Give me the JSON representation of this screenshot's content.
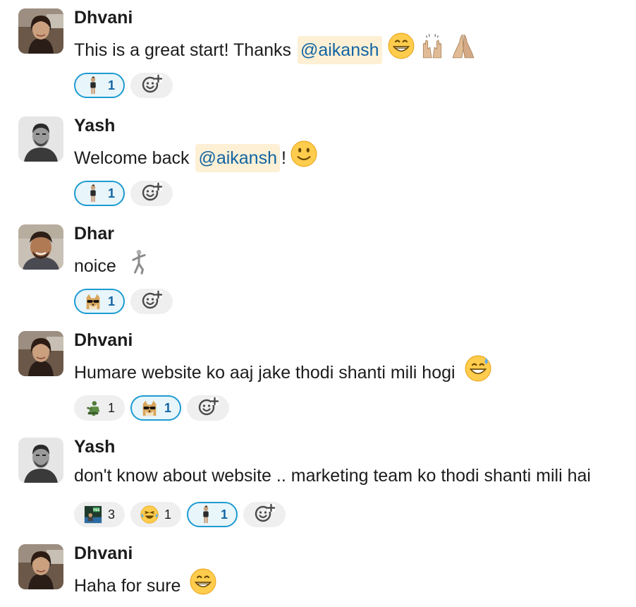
{
  "messages": [
    {
      "author": "Dhvani",
      "avatar": "dhvani-avatar",
      "parts": [
        {
          "type": "text",
          "value": "This is a great start! Thanks "
        },
        {
          "type": "mention",
          "value": "@aikansh"
        },
        {
          "type": "emoji",
          "icon": "grin-emoji"
        },
        {
          "type": "emoji",
          "icon": "raised-hands-emoji"
        },
        {
          "type": "emoji",
          "icon": "folded-hands-emoji"
        }
      ],
      "reactions": [
        {
          "icon": "standing-person-emoji",
          "count": "1",
          "active": true
        }
      ]
    },
    {
      "author": "Yash",
      "avatar": "yash-avatar",
      "parts": [
        {
          "type": "text",
          "value": "Welcome back "
        },
        {
          "type": "mention",
          "value": "@aikansh"
        },
        {
          "type": "text",
          "value": "!"
        },
        {
          "type": "emoji",
          "icon": "slight-smile-emoji"
        }
      ],
      "reactions": [
        {
          "icon": "standing-person-emoji",
          "count": "1",
          "active": true
        }
      ]
    },
    {
      "author": "Dhar",
      "avatar": "dhar-avatar",
      "parts": [
        {
          "type": "text",
          "value": "noice "
        },
        {
          "type": "emoji",
          "icon": "dancing-figure-emoji"
        }
      ],
      "reactions": [
        {
          "icon": "doge-sunglasses-emoji",
          "count": "1",
          "active": true
        }
      ]
    },
    {
      "author": "Dhvani",
      "avatar": "dhvani-avatar",
      "parts": [
        {
          "type": "text",
          "value": "Humare website ko aaj jake thodi shanti mili hogi "
        },
        {
          "type": "emoji",
          "icon": "sweat-smile-emoji"
        }
      ],
      "reactions": [
        {
          "icon": "thinking-figure-emoji",
          "count": "1",
          "active": false
        },
        {
          "icon": "doge-sunglasses-emoji",
          "count": "1",
          "active": true
        }
      ]
    },
    {
      "author": "Yash",
      "avatar": "yash-avatar",
      "parts": [
        {
          "type": "text",
          "value": "don't know about website .. marketing team ko thodi shanti mili hai"
        }
      ],
      "reactions": [
        {
          "icon": "yes-sign-emoji",
          "count": "3",
          "active": false
        },
        {
          "icon": "joy-emoji",
          "count": "1",
          "active": false
        },
        {
          "icon": "standing-person-emoji",
          "count": "1",
          "active": true
        }
      ]
    },
    {
      "author": "Dhvani",
      "avatar": "dhvani-avatar",
      "parts": [
        {
          "type": "text",
          "value": "Haha for sure "
        },
        {
          "type": "emoji",
          "icon": "grin-emoji"
        }
      ],
      "reactions": []
    }
  ],
  "colors": {
    "mention_bg": "#fdf0d5",
    "mention_text": "#1264a3",
    "active_reaction_border": "#1d9bd1",
    "active_reaction_bg": "#e8f5fa"
  }
}
